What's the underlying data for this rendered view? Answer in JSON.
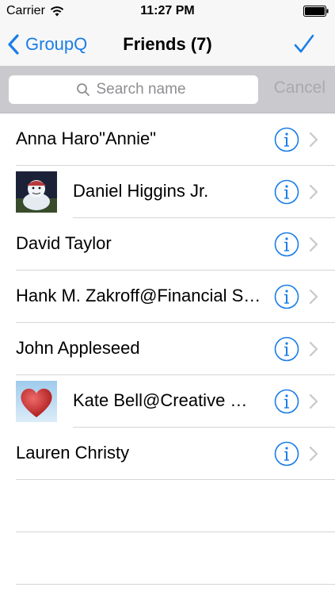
{
  "status_bar": {
    "carrier": "Carrier",
    "time": "11:27 PM"
  },
  "nav": {
    "back_label": "GroupQ",
    "title": "Friends (7)",
    "accent_color": "#1a7ee8"
  },
  "search": {
    "placeholder": "Search name",
    "cancel_label": "Cancel"
  },
  "contacts": [
    {
      "name": "Anna Haro\"Annie\"",
      "photo": null
    },
    {
      "name": "Daniel Higgins Jr.",
      "photo": "snowman-photo"
    },
    {
      "name": "David Taylor",
      "photo": null
    },
    {
      "name": "Hank M. Zakroff@Financial Services Inc.",
      "photo": null
    },
    {
      "name": "John Appleseed",
      "photo": null
    },
    {
      "name": "Kate Bell@Creative Consulting",
      "photo": "heart-photo"
    },
    {
      "name": "Lauren Christy",
      "photo": null
    }
  ]
}
